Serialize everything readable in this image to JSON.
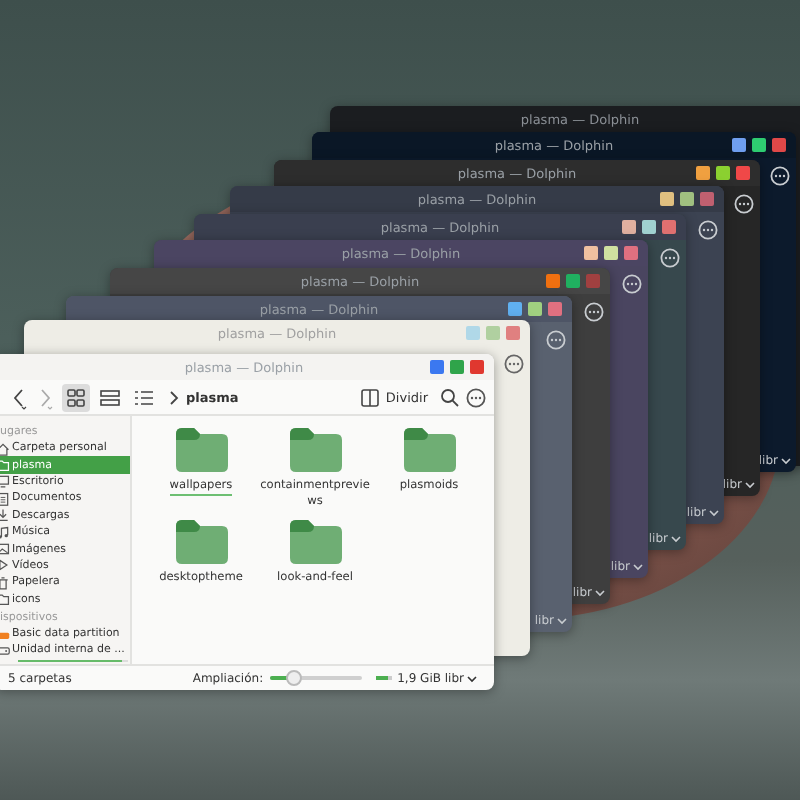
{
  "background_windows": [
    {
      "title": "plasma — Dolphin"
    },
    {
      "title": "plasma — Dolphin",
      "buttons": [
        {
          "color": "#6f9ff0"
        },
        {
          "color": "#2ecc71"
        },
        {
          "color": "#e04848"
        }
      ],
      "footer": "libr"
    },
    {
      "title": "plasma — Dolphin",
      "buttons": [
        {
          "color": "#f0a040"
        },
        {
          "color": "#8bd030"
        },
        {
          "color": "#f04848"
        }
      ],
      "footer": "libr"
    },
    {
      "title": "plasma — Dolphin",
      "buttons": [
        {
          "color": "#e0c080"
        },
        {
          "color": "#a0c080"
        },
        {
          "color": "#c06070"
        }
      ],
      "footer": "libr"
    },
    {
      "title": "plasma — Dolphin",
      "buttons": [
        {
          "color": "#e0b0a0"
        },
        {
          "color": "#a0d0d0"
        },
        {
          "color": "#e07070"
        }
      ],
      "footer": "libr"
    },
    {
      "title": "plasma — Dolphin",
      "buttons": [
        {
          "color": "#f0c0a0"
        },
        {
          "color": "#d0e0a0"
        },
        {
          "color": "#e07080"
        }
      ],
      "footer": "libr"
    },
    {
      "title": "plasma — Dolphin",
      "buttons": [
        {
          "color": "#f07010"
        },
        {
          "color": "#20b060"
        },
        {
          "color": "#a04040"
        }
      ],
      "footer": "libr"
    },
    {
      "title": "plasma — Dolphin",
      "buttons": [
        {
          "color": "#60b0f0"
        },
        {
          "color": "#a0d080"
        },
        {
          "color": "#e07080"
        }
      ],
      "footer": "libr"
    },
    {
      "title": "plasma — Dolphin",
      "buttons": [
        {
          "color": "#b0d8e8"
        },
        {
          "color": "#b0d0a0"
        },
        {
          "color": "#e08080"
        }
      ]
    }
  ],
  "front_window": {
    "title": "plasma — Dolphin",
    "buttons": [
      {
        "color": "#3b78f0"
      },
      {
        "color": "#2fa44a"
      },
      {
        "color": "#e0382f"
      }
    ],
    "toolbar": {
      "view_modes": [
        {
          "kind": "icons",
          "selected": true
        },
        {
          "kind": "compact",
          "selected": false
        },
        {
          "kind": "details",
          "selected": false
        }
      ],
      "breadcrumb": "plasma",
      "split_label": "Dividir"
    },
    "sidebar": [
      {
        "heading": "ugares",
        "items": [
          {
            "kind": "home",
            "label": "Carpeta personal",
            "selected": false
          },
          {
            "kind": "folder",
            "label": "plasma",
            "selected": true
          },
          {
            "kind": "desktop",
            "label": "Escritorio",
            "selected": false
          },
          {
            "kind": "documents",
            "label": "Documentos",
            "selected": false
          },
          {
            "kind": "downloads",
            "label": "Descargas",
            "selected": false
          },
          {
            "kind": "music",
            "label": "Música",
            "selected": false
          },
          {
            "kind": "pictures",
            "label": "Imágenes",
            "selected": false
          },
          {
            "kind": "videos",
            "label": "Vídeos",
            "selected": false
          },
          {
            "kind": "trash",
            "label": "Papelera",
            "selected": false
          },
          {
            "kind": "folder",
            "label": "icons",
            "selected": false
          }
        ]
      },
      {
        "heading": "ispositivos",
        "items": [
          {
            "kind": "partition",
            "label": "Basic data partition",
            "selected": false
          },
          {
            "kind": "drive",
            "label": "Unidad interna de ...",
            "selected": false,
            "level": 0.95
          }
        ]
      }
    ],
    "folders": [
      {
        "name": "wallpapers",
        "focused": true
      },
      {
        "name": "containmentpreviews",
        "focused": false
      },
      {
        "name": "plasmoids",
        "focused": false
      },
      {
        "name": "desktoptheme",
        "focused": false
      },
      {
        "name": "look-and-feel",
        "focused": false
      }
    ],
    "status_bar": {
      "count": "5 carpetas",
      "zoom_label": "Ampliación:",
      "zoom": {
        "level": 0.3
      },
      "free_space": {
        "level": 0.85,
        "label": "1,9 GiB libr"
      }
    }
  }
}
